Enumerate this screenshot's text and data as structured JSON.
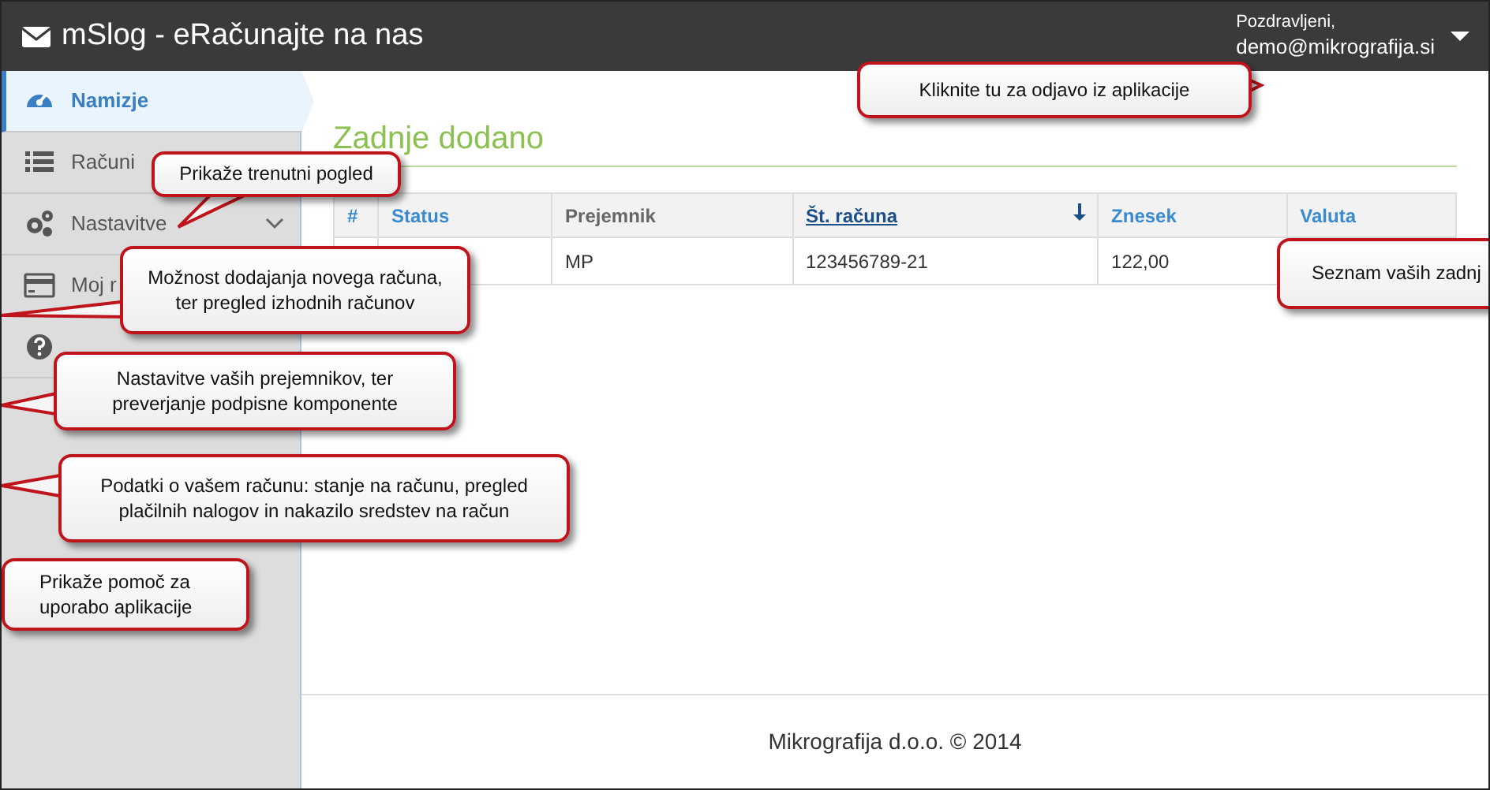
{
  "navbar": {
    "title": "mSlog - eRačunajte na nas",
    "greeting": "Pozdravljeni,",
    "user": "demo@mikrografija.si"
  },
  "sidebar": {
    "items": [
      {
        "label": "Namizje",
        "selected": true,
        "has_submenu": false
      },
      {
        "label": "Računi",
        "selected": false,
        "has_submenu": false
      },
      {
        "label": "Nastavitve",
        "selected": false,
        "has_submenu": true
      },
      {
        "label": "Moj r",
        "selected": false,
        "has_submenu": false
      },
      {
        "selected": false,
        "has_submenu": false
      }
    ]
  },
  "content": {
    "heading": "Zadnje dodano",
    "table": {
      "columns": [
        {
          "label": "#",
          "kind": "sortable"
        },
        {
          "label": "Status",
          "kind": "sortable"
        },
        {
          "label": "Prejemnik",
          "kind": "plain"
        },
        {
          "label": "Št. računa",
          "kind": "sorted"
        },
        {
          "label": "Znesek",
          "kind": "sortable"
        },
        {
          "label": "Valuta",
          "kind": "sortable"
        }
      ],
      "rows": [
        {
          "recipient": "MP",
          "invoice_number": "123456789-21",
          "amount": "122,00"
        }
      ]
    }
  },
  "footer": "Mikrografija d.o.o. © 2014",
  "callouts": [
    {
      "text": "Kliknite tu za odjavo iz aplikacije"
    },
    {
      "text": "Prikaže trenutni pogled"
    },
    {
      "text": "Možnost dodajanja novega računa, ter pregled izhodnih računov"
    },
    {
      "text": "Nastavitve vaših prejemnikov, ter preverjanje podpisne komponente"
    },
    {
      "text": "Podatki o vašem računu: stanje na računu, pregled plačilnih nalogov in nakazilo sredstev na račun"
    },
    {
      "text": "Prikaže pomoč za uporabo aplikacije"
    },
    {
      "text": "Seznam vaših zadnj"
    }
  ]
}
